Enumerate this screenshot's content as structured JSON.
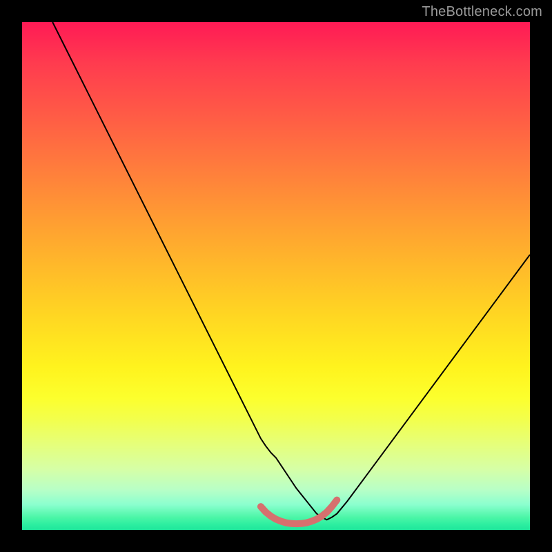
{
  "watermark": "TheBottleneck.com",
  "chart_data": {
    "type": "line",
    "title": "",
    "xlabel": "",
    "ylabel": "",
    "xlim": [
      0,
      100
    ],
    "ylim": [
      0,
      100
    ],
    "background_gradient": {
      "top": "#ff1a55",
      "bottom": "#1fe69b"
    },
    "series": [
      {
        "name": "primary-curve",
        "color": "#000000",
        "stroke_width": 2,
        "x": [
          6,
          10,
          14,
          18,
          22,
          26,
          30,
          34,
          38,
          42,
          46,
          47,
          48,
          49,
          50,
          54,
          58,
          59,
          60,
          61,
          62,
          64,
          68,
          72,
          76,
          80,
          84,
          88,
          92,
          96,
          100
        ],
        "values": [
          100,
          92,
          84,
          76,
          68,
          60,
          52,
          44,
          36,
          28,
          20,
          18,
          16.5,
          15.2,
          14.2,
          8.2,
          3.2,
          2.5,
          2.0,
          2.5,
          3.2,
          5.6,
          11,
          16.4,
          21.8,
          27.2,
          32.6,
          38,
          43.4,
          48.8,
          54.2
        ]
      },
      {
        "name": "bottom-highlight-band",
        "color": "#d6706e",
        "stroke_width": 10,
        "linecap": "round",
        "x": [
          47,
          48,
          49,
          50,
          51,
          52,
          53,
          54,
          55,
          56,
          57,
          58,
          59,
          60,
          61,
          62
        ],
        "values": [
          4.6,
          3.5,
          2.7,
          2.1,
          1.7,
          1.4,
          1.25,
          1.2,
          1.25,
          1.4,
          1.7,
          2.1,
          2.7,
          3.5,
          4.6,
          5.9
        ]
      }
    ]
  }
}
